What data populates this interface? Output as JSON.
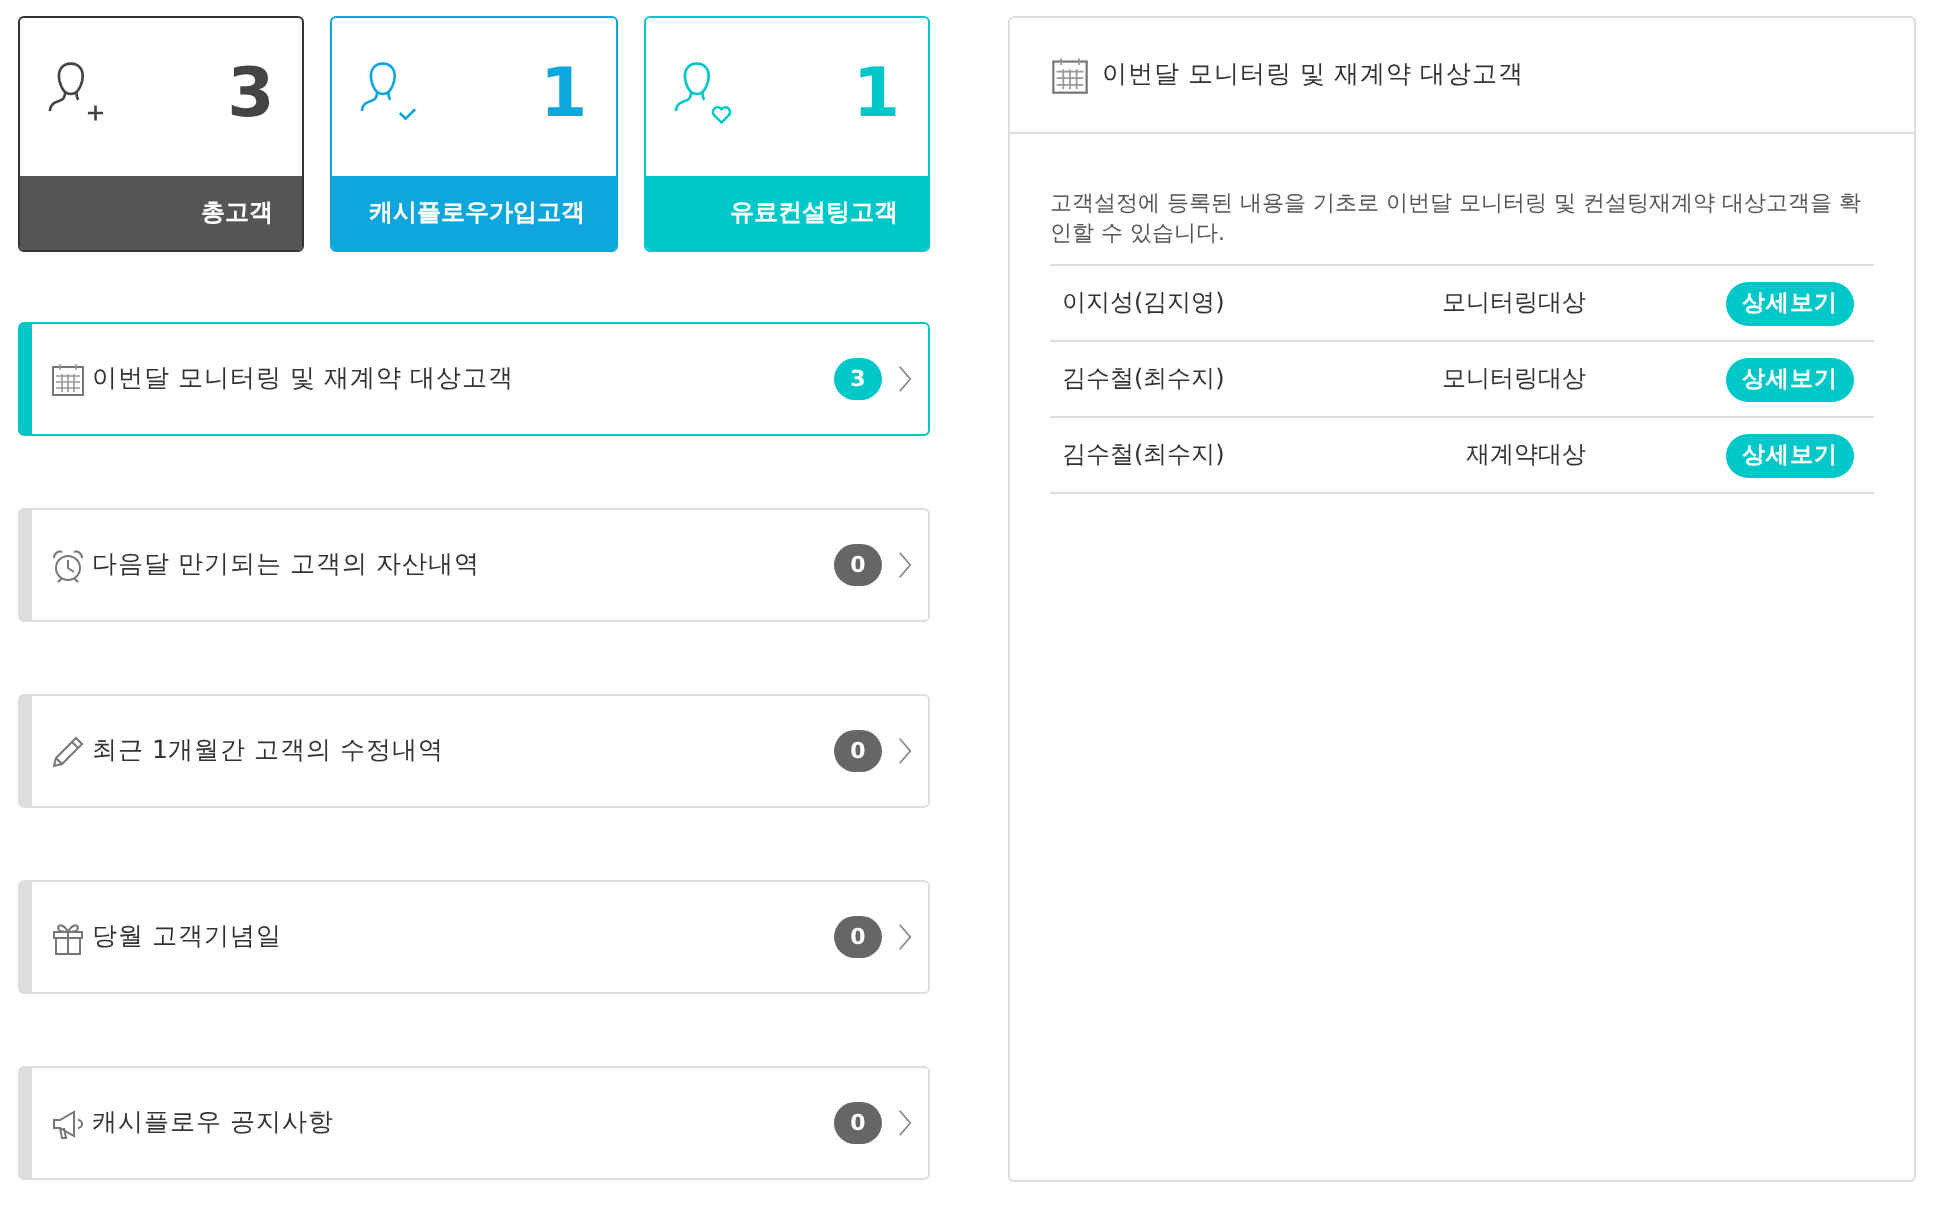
{
  "stat_cards": [
    {
      "kind": "plus",
      "count": "3",
      "label": "총고객"
    },
    {
      "kind": "check",
      "count": "1",
      "label": "캐시플로우가입고객"
    },
    {
      "kind": "heart",
      "count": "1",
      "label": "유료컨설팅고객"
    }
  ],
  "menu": [
    {
      "kind": "calendar",
      "label": "이번달 모니터링 및 재계약 대상고객",
      "count": "3",
      "selected": true
    },
    {
      "kind": "alarm",
      "label": "다음달 만기되는 고객의 자산내역",
      "count": "0",
      "selected": false
    },
    {
      "kind": "pencil",
      "label": "최근 1개월간 고객의 수정내역",
      "count": "0",
      "selected": false
    },
    {
      "kind": "gift",
      "label": "당월 고객기념일",
      "count": "0",
      "selected": false
    },
    {
      "kind": "megaphone",
      "label": "캐시플로우 공지사항",
      "count": "0",
      "selected": false
    }
  ],
  "panel": {
    "title": "이번달 모니터링 및 재계약 대상고객",
    "description": "고객설정에 등록된 내용을 기초로 이번달 모니터링 및 컨설팅재계약 대상고객을 확인할 수 있습니다.",
    "rows": [
      {
        "name": "이지성(김지영)",
        "type": "모니터링대상",
        "button": "상세보기"
      },
      {
        "name": "김수철(최수지)",
        "type": "모니터링대상",
        "button": "상세보기"
      },
      {
        "name": "김수철(최수지)",
        "type": "재계약대상",
        "button": "상세보기"
      }
    ]
  }
}
